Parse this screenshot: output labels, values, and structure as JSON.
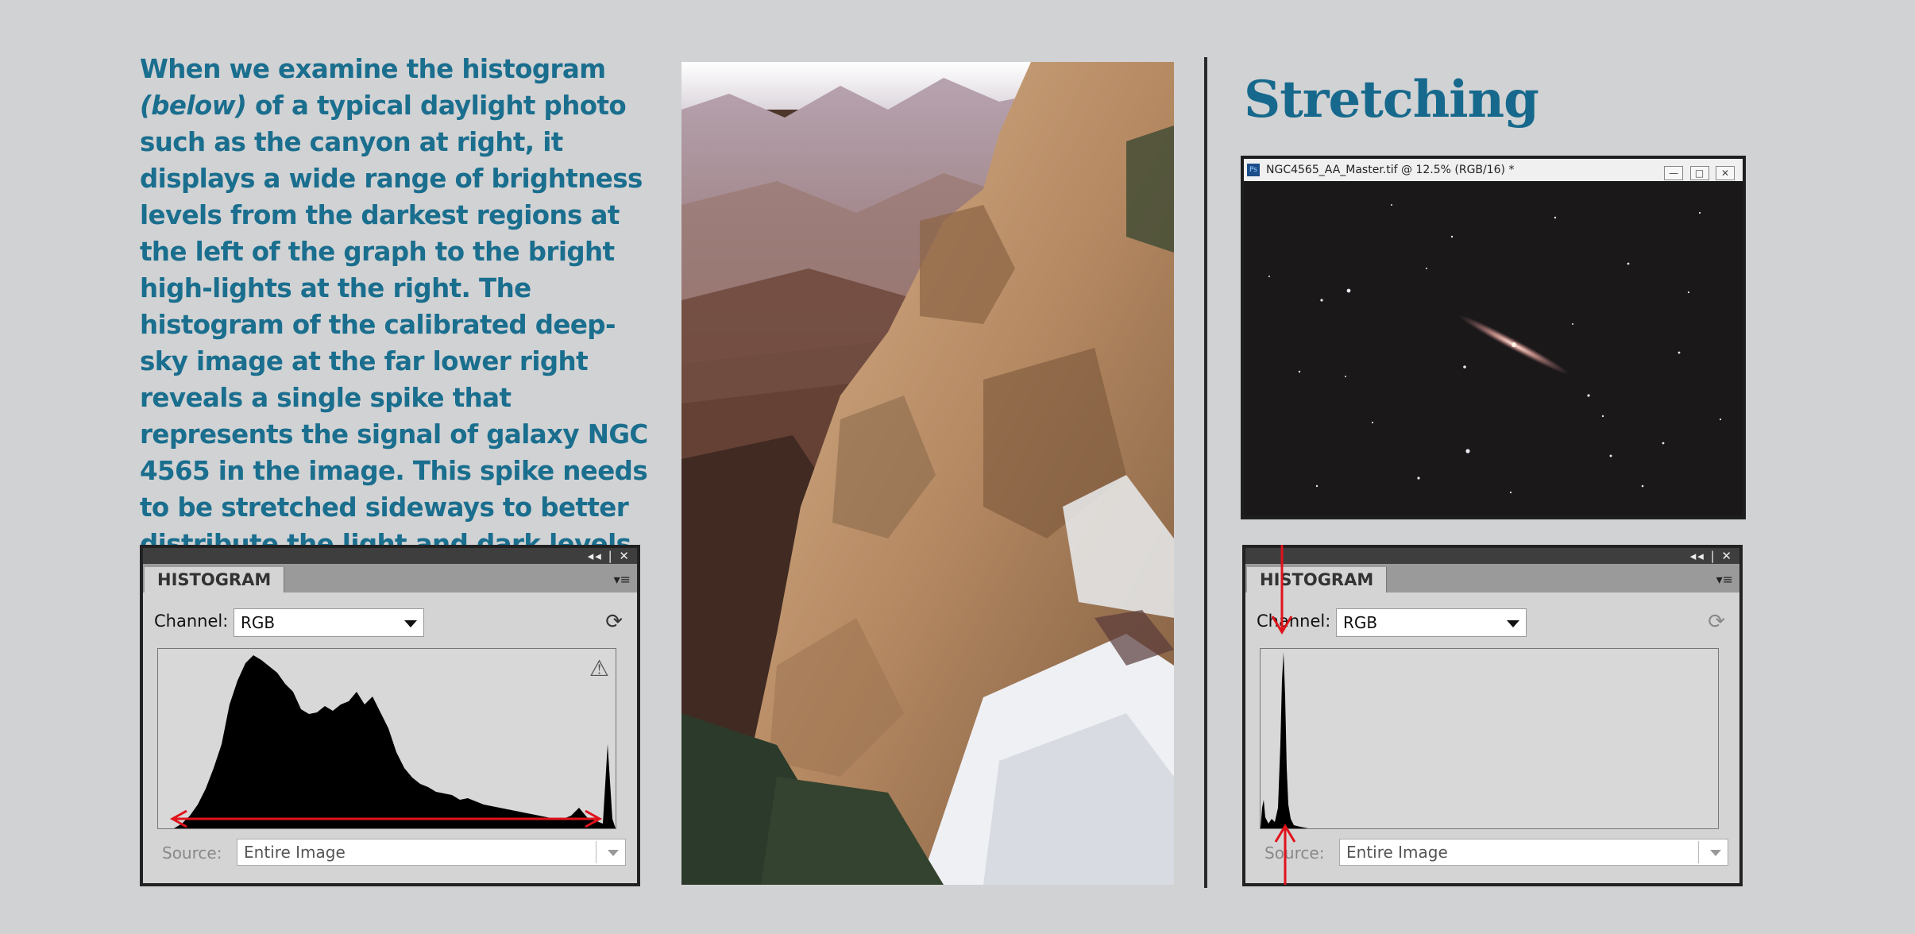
{
  "intro": {
    "line1a": "When we examine the histogram ",
    "line1b": "(below)",
    "rest": "of a typical daylight photo such as the canyon at right, it displays a wide range of brightness levels from the darkest regions at the left of the graph to the bright high-lights at the right. The histogram of the calibrated deep-sky image at the far lower right reveals a single spike that represents the signal of galaxy NGC 4565 in the image. This spike needs to be stretched sideways to better distribute the light and dark levels in the galaxy."
  },
  "title": "Stretching",
  "image_window": {
    "title": "NGC4565_AA_Master.tif @ 12.5% (RGB/16) *",
    "app_icon": "Ps",
    "buttons": [
      "—",
      "□",
      "✕"
    ]
  },
  "histogram_left": {
    "tab_label": "HISTOGRAM",
    "bar_controls": "◂◂ | ✕",
    "menu_icon": "▾≡",
    "channel_label": "Channel:",
    "channel_value": "RGB",
    "refresh_icon": "⟳",
    "warning_icon": "⚠",
    "source_label": "Source:",
    "source_value": "Entire Image"
  },
  "histogram_right": {
    "tab_label": "HISTOGRAM",
    "bar_controls": "◂◂ | ✕",
    "menu_icon": "▾≡",
    "channel_label": "Channel:",
    "channel_value": "RGB",
    "refresh_icon": "⟳",
    "source_label": "Source:",
    "source_value": "Entire Image"
  },
  "colors": {
    "accent_text": "#1a6e8e",
    "background": "#d1d2d4",
    "annotation_arrow": "#e0131b"
  }
}
